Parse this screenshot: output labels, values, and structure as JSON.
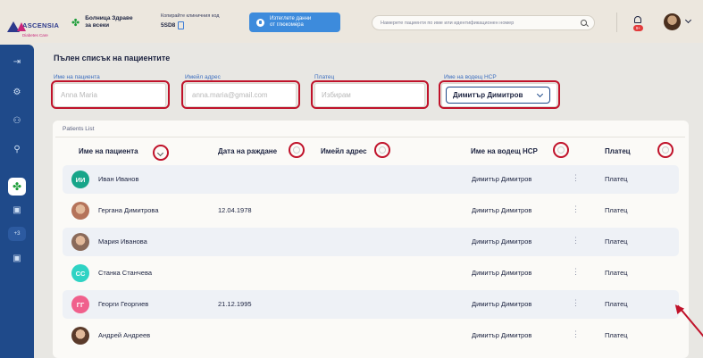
{
  "header": {
    "logo_text": "ASCENSIA",
    "logo_sub": "Diabetes Care",
    "clinic_name_line1": "Болница Здраве",
    "clinic_name_line2": "за всеки",
    "code_label": "Копирайте клиничния код",
    "code_value": "5SD8",
    "export_line1": "Изтеглете данни",
    "export_line2": "от глюкомера",
    "search_placeholder": "Намерете пациенти по име или идентификационен номер",
    "notification_badge": "9+"
  },
  "sidebar": {
    "more_label": "+3"
  },
  "page": {
    "title": "Пълен списък на пациентите"
  },
  "filters": {
    "patient_name_label": "Име на пациента",
    "patient_name_placeholder": "Anna Maria",
    "email_label": "Имейл адрес",
    "email_placeholder": "anna.maria@gmail.com",
    "payer_label": "Платец",
    "payer_placeholder": "Избирам",
    "hcp_label": "Име на водещ HCP",
    "hcp_value": "Димитър Димитров"
  },
  "table": {
    "card_title": "Patients List",
    "columns": [
      "Име на пациента",
      "Дата на раждане",
      "Имейл адрес",
      "Име на водещ HCP",
      "Платец"
    ],
    "rows": [
      {
        "initials": "ИИ",
        "color": "#17a589",
        "photo": false,
        "name": "Иван Иванов",
        "dob": "",
        "hcp": "Димитър Димитров",
        "payer": "Платец"
      },
      {
        "initials": "",
        "color": "#b5735a",
        "photo": true,
        "name": "Гергана Димитрова",
        "dob": "12.04.1978",
        "hcp": "Димитър Димитров",
        "payer": "Платец"
      },
      {
        "initials": "",
        "color": "#8a6a5a",
        "photo": true,
        "name": "Мария Иванова",
        "dob": "",
        "hcp": "Димитър Димитров",
        "payer": "Платец"
      },
      {
        "initials": "СС",
        "color": "#2fd3c4",
        "photo": false,
        "name": "Станка Станчева",
        "dob": "",
        "hcp": "Димитър Димитров",
        "payer": "Платец"
      },
      {
        "initials": "ГГ",
        "color": "#f0608c",
        "photo": false,
        "name": "Георги Георгиев",
        "dob": "21.12.1995",
        "hcp": "Димитър Димитров",
        "payer": "Платец"
      },
      {
        "initials": "",
        "color": "#5a3a2a",
        "photo": true,
        "name": "Андрей Андреев",
        "dob": "",
        "hcp": "Димитър Димитров",
        "payer": "Платец"
      }
    ]
  },
  "colors": {
    "accent": "#3d8bdc",
    "sidebar": "#1f4a8a",
    "highlight": "#c0122a"
  }
}
